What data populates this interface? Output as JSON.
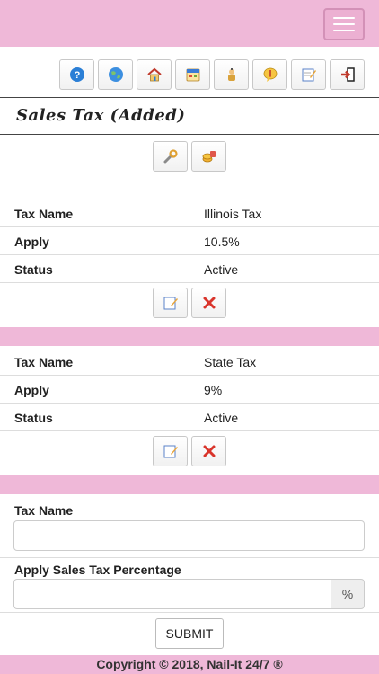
{
  "header": {
    "menu_icon": "hamburger-menu-icon"
  },
  "toolbar": {
    "icons": [
      "help-icon",
      "globe-icon",
      "home-icon",
      "calendar-icon",
      "staff-icon",
      "alert-icon",
      "edit-note-icon",
      "logout-icon"
    ]
  },
  "page": {
    "title": "Sales Tax (Added)"
  },
  "tools": {
    "icons": [
      "wrench-icon",
      "coins-icon"
    ]
  },
  "taxes": [
    {
      "rows": [
        {
          "label": "Tax Name",
          "value": "Illinois Tax"
        },
        {
          "label": "Apply",
          "value": "10.5%"
        },
        {
          "label": "Status",
          "value": "Active"
        }
      ]
    },
    {
      "rows": [
        {
          "label": "Tax Name",
          "value": "State Tax"
        },
        {
          "label": "Apply",
          "value": "9%"
        },
        {
          "label": "Status",
          "value": "Active"
        }
      ]
    }
  ],
  "form": {
    "tax_name_label": "Tax Name",
    "tax_name_value": "",
    "percent_label": "Apply Sales Tax Percentage",
    "percent_value": "",
    "percent_addon": "%",
    "submit_label": "SUBMIT"
  },
  "footer": {
    "text": "Copyright © 2018, Nail-It 24/7 ®"
  },
  "colors": {
    "accent_pink": "#efb8d8",
    "delete_red": "#d9342b"
  }
}
